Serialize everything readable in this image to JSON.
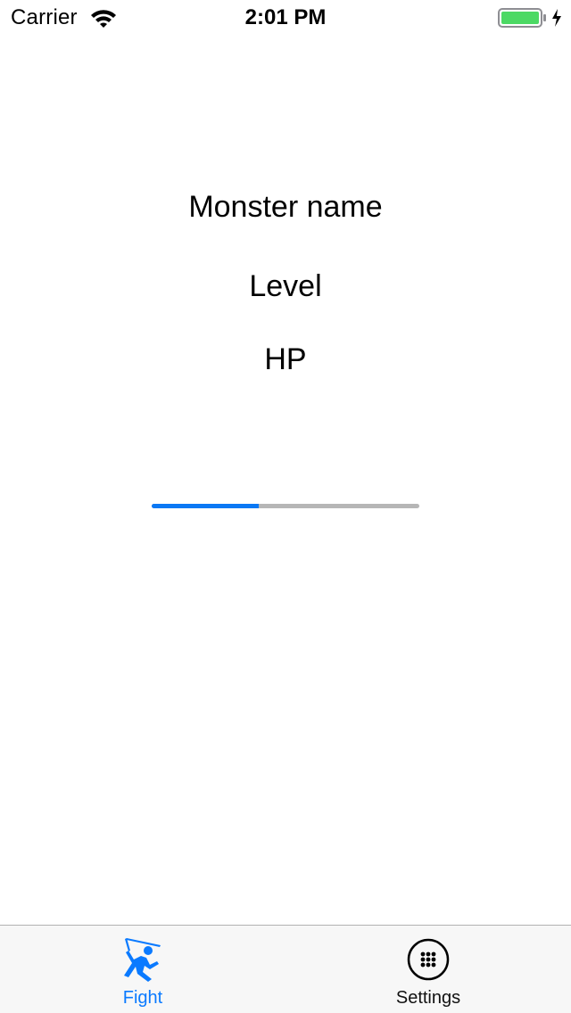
{
  "status_bar": {
    "carrier": "Carrier",
    "time": "2:01 PM",
    "battery_color": "#4cd964"
  },
  "monster": {
    "name_label": "Monster name",
    "level_label": "Level",
    "hp_label": "HP"
  },
  "hp_progress": {
    "fraction": 0.4,
    "fill_color": "#0a78f4",
    "track_color": "#b6b6b6"
  },
  "tab_bar": {
    "tabs": [
      {
        "label": "Fight",
        "icon": "fighter-icon",
        "selected": true,
        "color": "#0a7aff"
      },
      {
        "label": "Settings",
        "icon": "settings-dots-icon",
        "selected": false
      }
    ]
  }
}
